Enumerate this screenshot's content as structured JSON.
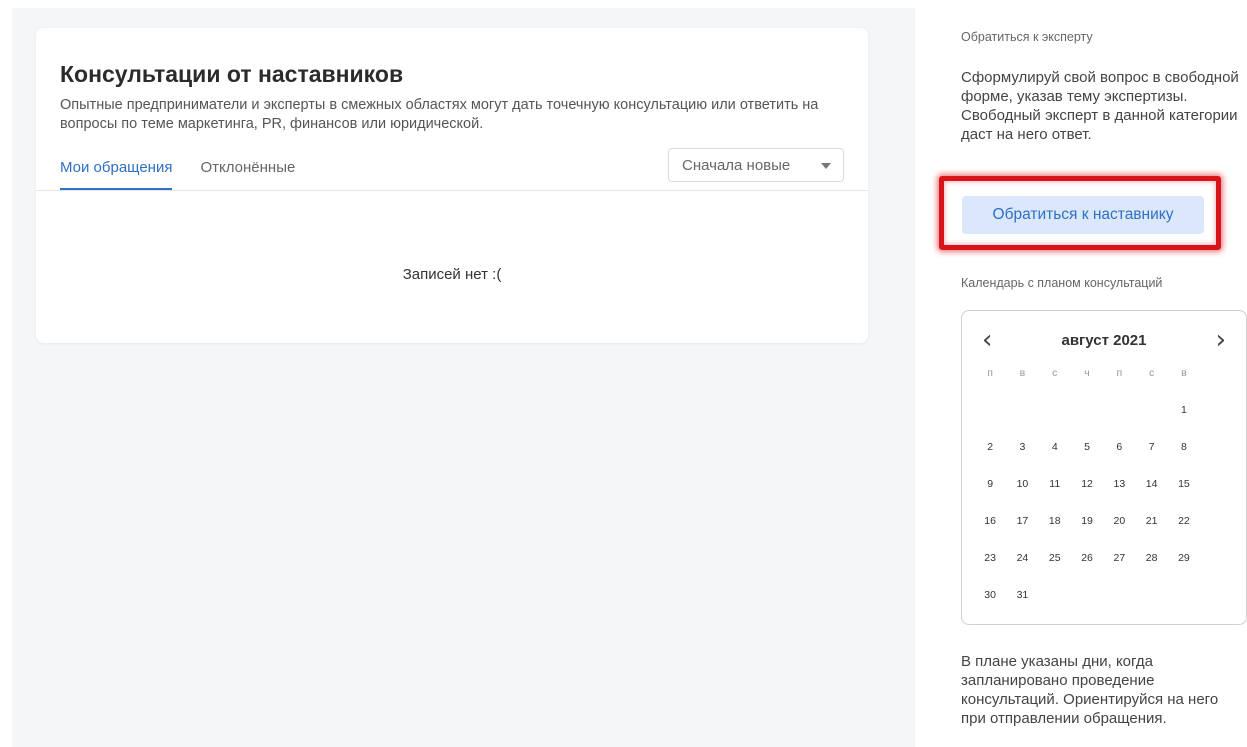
{
  "main": {
    "title": "Консультации от наставников",
    "description": "Опытные предприниматели и эксперты в смежных областях могут дать точечную консультацию или ответить на вопросы по теме маркетинга, PR, финансов или юридической.",
    "tabs": [
      {
        "label": "Мои обращения",
        "active": true
      },
      {
        "label": "Отклонённые",
        "active": false
      }
    ],
    "sort": {
      "selected": "Сначала новые"
    },
    "empty_text": "Записей нет :("
  },
  "sidebar": {
    "ask_caption": "Обратиться к эксперту",
    "ask_text": "Сформулируй свой вопрос в свободной форме, указав тему экспертизы. Свободный эксперт в данной категории даст на него ответ.",
    "mentor_button": "Обратиться к наставнику",
    "calendar_caption": "Календарь с планом консультаций",
    "calendar": {
      "month_label": "август 2021",
      "prev_icon": "‹",
      "next_icon": "›",
      "weekdays": [
        "п",
        "в",
        "с",
        "ч",
        "п",
        "с",
        "в"
      ],
      "weeks": [
        [
          "",
          "",
          "",
          "",
          "",
          "",
          "1"
        ],
        [
          "2",
          "3",
          "4",
          "5",
          "6",
          "7",
          "8"
        ],
        [
          "9",
          "10",
          "11",
          "12",
          "13",
          "14",
          "15"
        ],
        [
          "16",
          "17",
          "18",
          "19",
          "20",
          "21",
          "22"
        ],
        [
          "23",
          "24",
          "25",
          "26",
          "27",
          "28",
          "29"
        ],
        [
          "30",
          "31",
          "",
          "",
          "",
          "",
          ""
        ]
      ]
    },
    "note": "В плане указаны дни, когда запланировано проведение консультаций. Ориентируйся на него при отправлении обращения."
  },
  "colors": {
    "accent": "#2f6fc4",
    "button_bg": "#dbe8fb",
    "highlight": "#d8131a",
    "page_bg": "#f5f6f8"
  },
  "icons": {
    "sort_dropdown": "caret-down-icon",
    "calendar_prev": "chevron-left-icon",
    "calendar_next": "chevron-right-icon"
  }
}
